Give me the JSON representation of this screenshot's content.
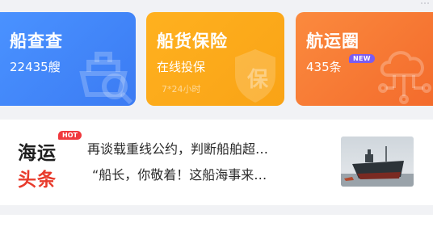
{
  "cards": [
    {
      "title": "船查查",
      "subtitle": "22435艘"
    },
    {
      "title": "船货保险",
      "subtitle": "在线投保",
      "note": "7*24小时",
      "watermark": "保"
    },
    {
      "title": "航运圈",
      "subtitle": "435条",
      "badge": "NEW"
    }
  ],
  "news": {
    "logo_top": "海运",
    "logo_bottom": "头条",
    "hot_badge": "HOT",
    "headlines": [
      "再谈载重线公约，判断船舶超…",
      "“船长，你敬着！这船海事来…"
    ]
  },
  "colors": {
    "blue": "#3b7bf3",
    "yellow": "#f9a316",
    "orange": "#f36b2c",
    "red": "#e83b2c",
    "badge_purple": "#7b5cf0"
  },
  "icons": [
    "ship-search-icon",
    "shield-icon",
    "cloud-network-icon",
    "ship-photo"
  ]
}
